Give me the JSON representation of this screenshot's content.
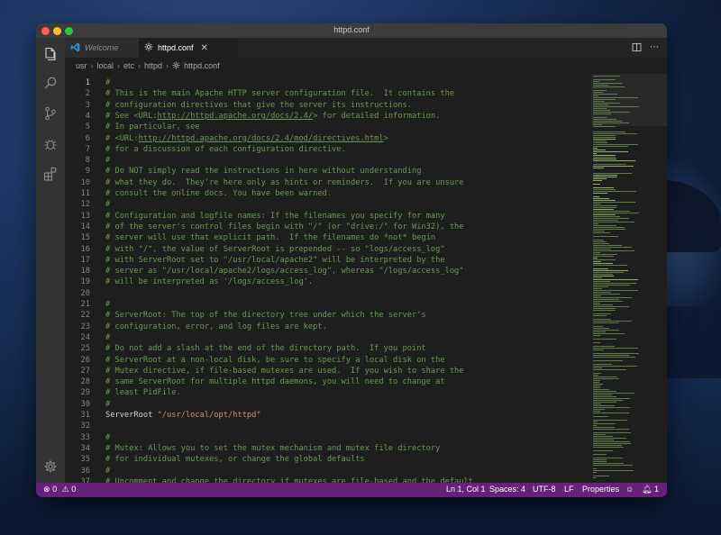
{
  "window": {
    "title": "httpd.conf"
  },
  "tabs": [
    {
      "label": "Welcome"
    },
    {
      "label": "httpd.conf"
    }
  ],
  "breadcrumb": [
    "usr",
    "local",
    "etc",
    "httpd",
    "httpd.conf"
  ],
  "editor": {
    "lines": [
      {
        "n": "1",
        "text": "#"
      },
      {
        "n": "2",
        "text": "# This is the main Apache HTTP server configuration file.  It contains the"
      },
      {
        "n": "3",
        "text": "# configuration directives that give the server its instructions."
      },
      {
        "n": "4",
        "pre": "# See <URL:",
        "url": "http://httpd.apache.org/docs/2.4/",
        "post": "> for detailed information."
      },
      {
        "n": "5",
        "text": "# In particular, see"
      },
      {
        "n": "6",
        "pre": "# <URL:",
        "url": "http://httpd.apache.org/docs/2.4/mod/directives.html",
        "post": ">"
      },
      {
        "n": "7",
        "text": "# for a discussion of each configuration directive."
      },
      {
        "n": "8",
        "text": "#"
      },
      {
        "n": "9",
        "text": "# Do NOT simply read the instructions in here without understanding"
      },
      {
        "n": "10",
        "text": "# what they do.  They're here only as hints or reminders.  If you are unsure"
      },
      {
        "n": "11",
        "text": "# consult the online docs. You have been warned."
      },
      {
        "n": "12",
        "text": "#"
      },
      {
        "n": "13",
        "text": "# Configuration and logfile names: If the filenames you specify for many"
      },
      {
        "n": "14",
        "text": "# of the server's control files begin with \"/\" (or \"drive:/\" for Win32), the"
      },
      {
        "n": "15",
        "text": "# server will use that explicit path.  If the filenames do *not* begin"
      },
      {
        "n": "16",
        "text": "# with \"/\", the value of ServerRoot is prepended -- so \"logs/access_log\""
      },
      {
        "n": "17",
        "text": "# with ServerRoot set to \"/usr/local/apache2\" will be interpreted by the"
      },
      {
        "n": "18",
        "text": "# server as \"/usr/local/apache2/logs/access_log\", whereas \"/logs/access_log\""
      },
      {
        "n": "19",
        "text": "# will be interpreted as '/logs/access_log'."
      },
      {
        "n": "20",
        "text": ""
      },
      {
        "n": "21",
        "text": "#"
      },
      {
        "n": "22",
        "text": "# ServerRoot: The top of the directory tree under which the server's"
      },
      {
        "n": "23",
        "text": "# configuration, error, and log files are kept."
      },
      {
        "n": "24",
        "text": "#"
      },
      {
        "n": "25",
        "text": "# Do not add a slash at the end of the directory path.  If you point"
      },
      {
        "n": "26",
        "text": "# ServerRoot at a non-local disk, be sure to specify a local disk on the"
      },
      {
        "n": "27",
        "text": "# Mutex directive, if file-based mutexes are used.  If you wish to share the"
      },
      {
        "n": "28",
        "text": "# same ServerRoot for multiple httpd daemons, you will need to change at"
      },
      {
        "n": "29",
        "text": "# least PidFile."
      },
      {
        "n": "30",
        "text": "#"
      },
      {
        "n": "31",
        "directive": "ServerRoot ",
        "value": "\"/usr/local/opt/httpd\""
      },
      {
        "n": "32",
        "text": ""
      },
      {
        "n": "33",
        "text": "#"
      },
      {
        "n": "34",
        "text": "# Mutex: Allows you to set the mutex mechanism and mutex file directory"
      },
      {
        "n": "35",
        "text": "# for individual mutexes, or change the global defaults"
      },
      {
        "n": "36",
        "text": "#"
      },
      {
        "n": "37",
        "text": "# Uncomment and change the directory if mutexes are file-based and the default"
      }
    ]
  },
  "statusbar": {
    "errors": "0",
    "warnings": "0",
    "position": "Ln 1, Col 1",
    "spaces": "Spaces: 4",
    "encoding": "UTF-8",
    "eol": "LF",
    "language": "Properties",
    "notifications": "1"
  },
  "colors": {
    "statusbar": "#68217a",
    "comment": "#6a9955",
    "string": "#ce9178",
    "editor_bg": "#1e1e1e"
  },
  "icons": {
    "activity": [
      "explorer-icon",
      "search-icon",
      "source-control-icon",
      "debug-icon",
      "extensions-icon",
      "settings-gear-icon"
    ],
    "tab_welcome": "vscode-logo-icon",
    "tab_file": "gear-file-icon"
  }
}
